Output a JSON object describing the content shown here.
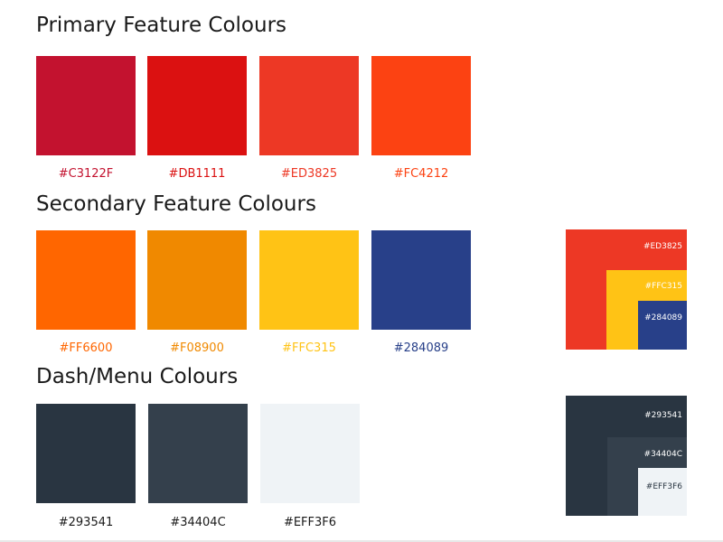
{
  "sections": {
    "primary": {
      "title": "Primary Feature Colours",
      "swatches": [
        {
          "color": "#C3122F",
          "label": "#C3122F",
          "text_color": "#C3122F"
        },
        {
          "color": "#DB1111",
          "label": "#DB1111",
          "text_color": "#DB1111"
        },
        {
          "color": "#ED3825",
          "label": "#ED3825",
          "text_color": "#ED3825"
        },
        {
          "color": "#FC4212",
          "label": "#FC4212",
          "text_color": "#FC4212"
        }
      ]
    },
    "secondary": {
      "title": "Secondary Feature Colours",
      "swatches": [
        {
          "color": "#FF6600",
          "label": "#FF6600",
          "text_color": "#FF6600"
        },
        {
          "color": "#F08900",
          "label": "#F08900",
          "text_color": "#F08900"
        },
        {
          "color": "#FFC315",
          "label": "#FFC315",
          "text_color": "#FFC315"
        },
        {
          "color": "#284089",
          "label": "#284089",
          "text_color": "#284089"
        }
      ]
    },
    "dash": {
      "title": "Dash/Menu Colours",
      "swatches": [
        {
          "color": "#293541",
          "label": "#293541",
          "text_color": "#1a1a1a"
        },
        {
          "color": "#34404C",
          "label": "#34404C",
          "text_color": "#1a1a1a"
        },
        {
          "color": "#EFF3F6",
          "label": "#EFF3F6",
          "text_color": "#1a1a1a"
        }
      ]
    }
  },
  "stacks": {
    "feature": {
      "layers": [
        {
          "color": "#ED3825",
          "label": "#ED3825",
          "text_color": "#ffffff"
        },
        {
          "color": "#FFC315",
          "label": "#FFC315",
          "text_color": "#ffffff"
        },
        {
          "color": "#284089",
          "label": "#284089",
          "text_color": "#ffffff"
        }
      ]
    },
    "dash": {
      "layers": [
        {
          "color": "#293541",
          "label": "#293541",
          "text_color": "#ffffff"
        },
        {
          "color": "#34404C",
          "label": "#34404C",
          "text_color": "#ffffff"
        },
        {
          "color": "#EFF3F6",
          "label": "#EFF3F6",
          "text_color": "#293541"
        }
      ]
    }
  }
}
